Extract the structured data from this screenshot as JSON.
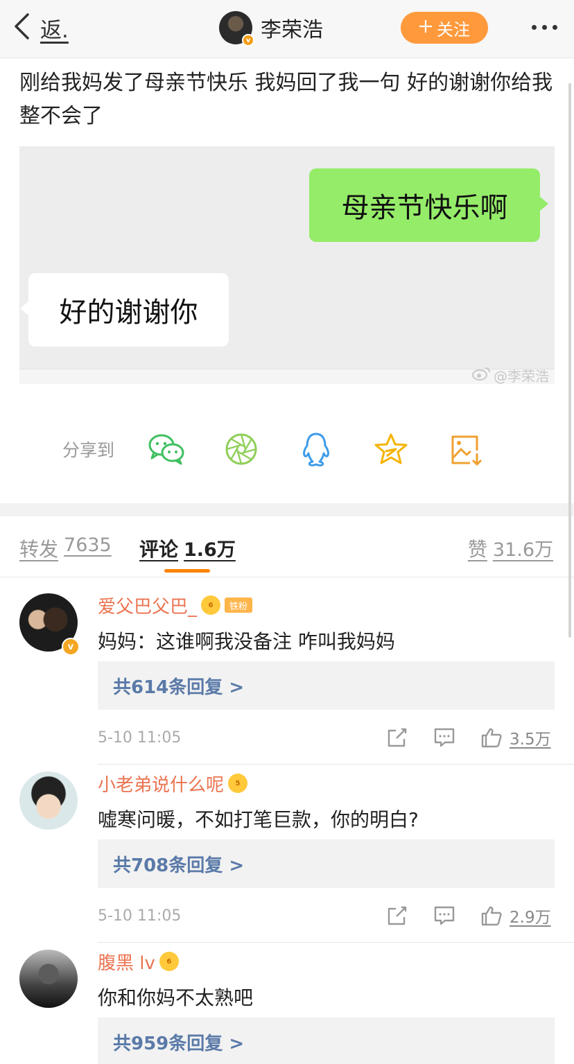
{
  "topbar": {
    "back_label": "返.",
    "author_name": "李荣浩",
    "verified_badge": "v",
    "follow_label": "关注"
  },
  "post": {
    "text": "刚给我妈发了母亲节快乐 我妈回了我一句 好的谢谢你给我整不会了",
    "image": {
      "sent_message": "母亲节快乐啊",
      "received_message": "好的谢谢你",
      "watermark": "@李荣浩"
    }
  },
  "share": {
    "label": "分享到",
    "targets": [
      "wechat-icon",
      "moments-icon",
      "qq-icon",
      "qzone-star-icon",
      "save-image-icon"
    ]
  },
  "tabs": {
    "repost_label": "转发",
    "repost_count": "7635",
    "comments_label": "评论",
    "comments_count": "1.6万",
    "likes_label": "赞",
    "likes_count": "31.6万"
  },
  "comments": [
    {
      "username": "爱父巴父巴_",
      "level": "6",
      "fan_tag": "铁粉",
      "verified_badge": "v",
      "text": "妈妈：这谁啊我没备注 咋叫我妈妈",
      "replies": "共614条回复 >",
      "time": "5-10 11:05",
      "likes": "3.5万"
    },
    {
      "username": "小老弟说什么呢",
      "level": "5",
      "text": "嘘寒问暖，不如打笔巨款，你的明白?",
      "replies": "共708条回复 >",
      "time": "5-10 11:05",
      "likes": "2.9万"
    },
    {
      "username": "腹黑 lv",
      "level": "6",
      "text": "你和你妈不太熟吧",
      "replies": "共959条回复 >"
    }
  ],
  "colors": {
    "accent": "#ff8200",
    "follow_button": "#ff9a3c",
    "username": "#eb7350",
    "reply_link": "#5a7aa8",
    "wechat_bubble": "#95ec69",
    "share_wechat": "#3fbf5f",
    "share_moments": "#8fcf5a",
    "share_qq": "#3d9be9",
    "share_qzone": "#f5b300",
    "share_save": "#f0a030"
  }
}
